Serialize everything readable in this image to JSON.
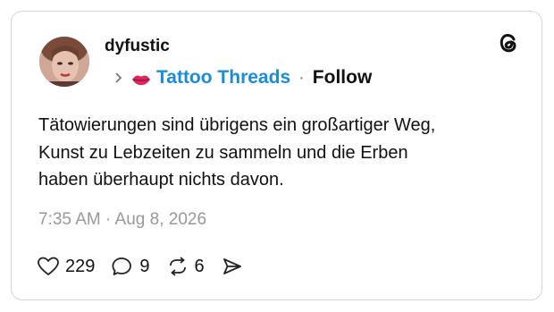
{
  "post": {
    "username": "dyfustic",
    "community_name": "Tattoo Threads",
    "separator": "·",
    "follow_label": "Follow",
    "text_lines": [
      "Tätowierungen sind übrigens ein großartiger Weg,",
      "Kunst zu Lebzeiten zu sammeln und die Erben",
      "haben überhaupt nichts davon."
    ],
    "timestamp": "7:35 AM · Aug 8, 2026",
    "likes": "229",
    "replies": "9",
    "reposts": "6"
  },
  "icons": {
    "logo": "threads-logo-icon",
    "chevron": "chevron-right-icon",
    "community_badge": "lips-icon",
    "like": "heart-icon",
    "reply": "comment-icon",
    "repost": "repost-icon",
    "share": "send-icon"
  },
  "colors": {
    "community_link": "#1a8cd8",
    "timestamp": "#999999",
    "border": "#d6d6d6",
    "badge": "#e0245e"
  }
}
